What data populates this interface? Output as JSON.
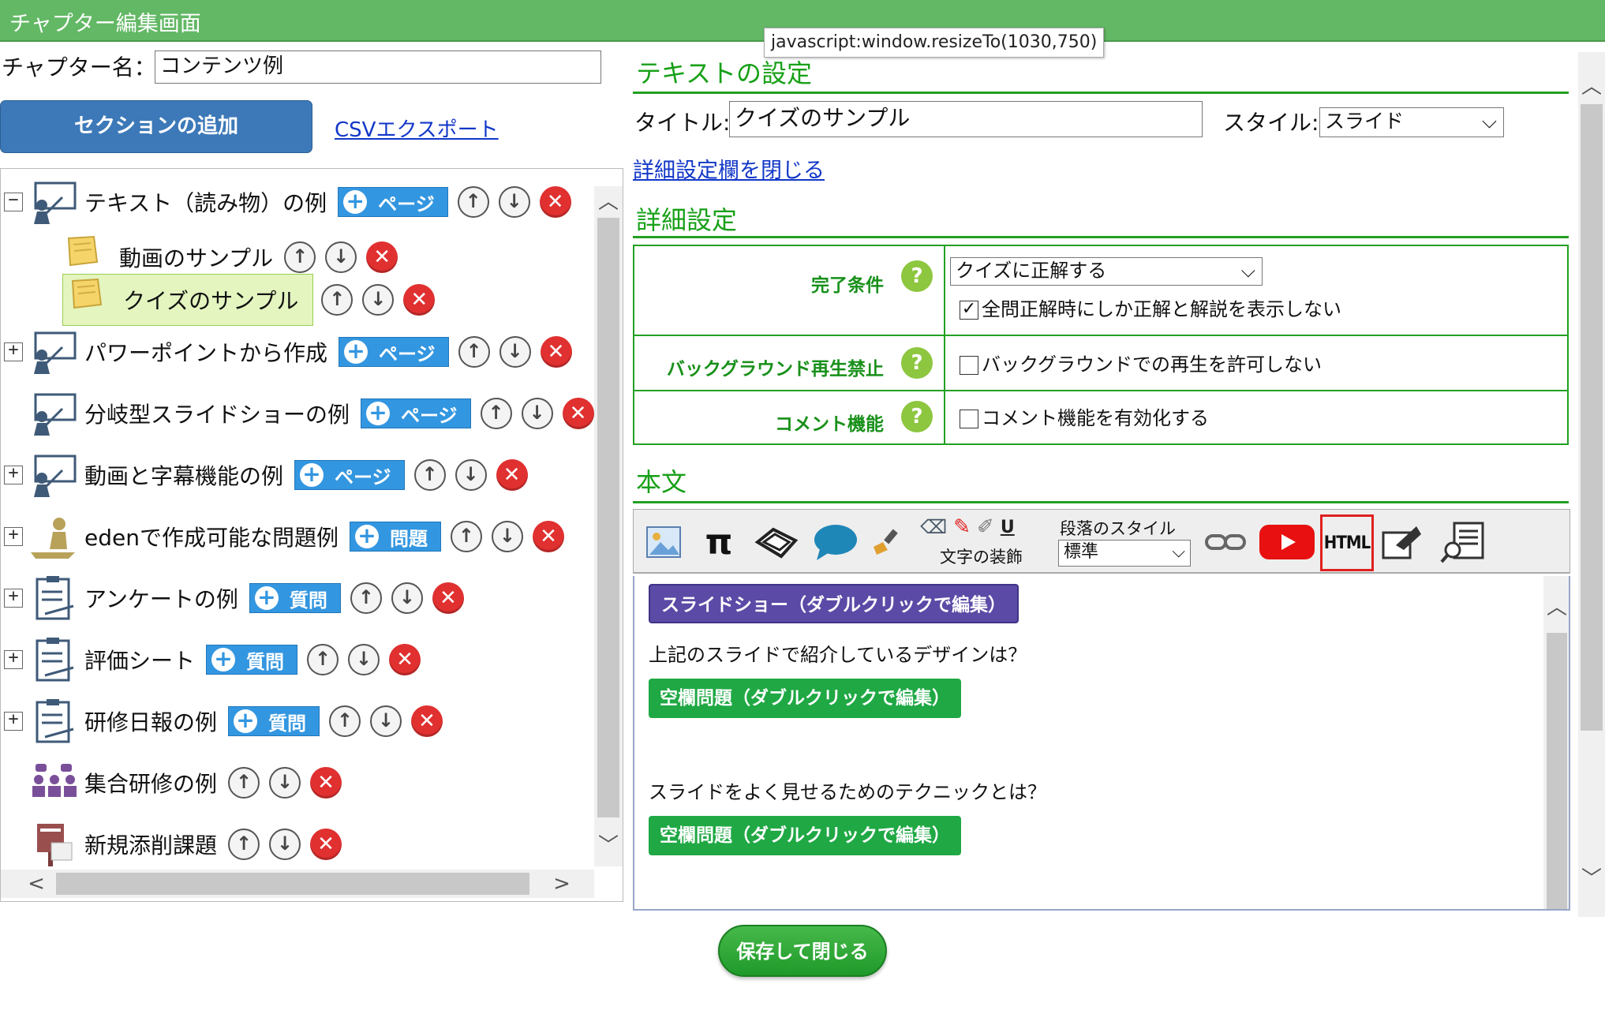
{
  "window": {
    "title": "チャプター編集画面"
  },
  "tooltip": "javascript:window.resizeTo(1030,750)",
  "chapter": {
    "label": "チャプター名：",
    "value": "コンテンツ例"
  },
  "actions": {
    "add_section": "セクションの追加",
    "csv_export": "CSVエクスポート"
  },
  "tree": {
    "nodes": [
      {
        "label": "テキスト（読み物）の例",
        "expander": "−",
        "add": "ページ",
        "icon": "presenter"
      },
      {
        "label": "動画のサンプル",
        "icon": "note"
      },
      {
        "label": "クイズのサンプル",
        "icon": "note",
        "selected": true
      },
      {
        "label": "パワーポイントから作成",
        "expander": "+",
        "add": "ページ",
        "icon": "presenter"
      },
      {
        "label": "分岐型スライドショーの例",
        "add": "ページ",
        "icon": "presenter"
      },
      {
        "label": "動画と字幕機能の例",
        "expander": "+",
        "add": "ページ",
        "icon": "presenter"
      },
      {
        "label": "edenで作成可能な問題例",
        "expander": "+",
        "add": "問題",
        "icon": "student"
      },
      {
        "label": "アンケートの例",
        "expander": "+",
        "add": "質問",
        "icon": "clipboard"
      },
      {
        "label": "評価シート",
        "expander": "+",
        "add": "質問",
        "icon": "clipboard"
      },
      {
        "label": "研修日報の例",
        "expander": "+",
        "add": "質問",
        "icon": "clipboard"
      },
      {
        "label": "集合研修の例",
        "icon": "group"
      },
      {
        "label": "新規添削課題",
        "icon": "post"
      }
    ]
  },
  "text_settings": {
    "heading": "テキストの設定",
    "title_label": "タイトル:",
    "title_value": "クイズのサンプル",
    "style_label": "スタイル:",
    "style_value": "スライド",
    "toggle_link": "詳細設定欄を閉じる"
  },
  "detail": {
    "heading": "詳細設定",
    "completion_label": "完了条件",
    "completion_value": "クイズに正解する",
    "completion_check": "全問正解時にしか正解と解説を表示しない",
    "bg_label": "バックグラウンド再生禁止",
    "bg_check": "バックグラウンドでの再生を許可しない",
    "comment_label": "コメント機能",
    "comment_check": "コメント機能を有効化する"
  },
  "body_section": {
    "heading": "本文",
    "decoration_label": "文字の装飾",
    "para_style_label": "段落のスタイル",
    "para_style_value": "標準",
    "html_label": "HTML",
    "pi": "π"
  },
  "editor": {
    "slideshow": "スライドショー（ダブルクリックで編集）",
    "q1": "上記のスライドで紹介しているデザインは？",
    "blank1": "空欄問題（ダブルクリックで編集）",
    "q2": "スライドをよく見せるためのテクニックとは？",
    "blank2": "空欄問題（ダブルクリックで編集）"
  },
  "save_button": "保存して閉じる",
  "colors": {
    "titlebar": "#63b865",
    "accent_green": "#22a022",
    "blue_button": "#3d79b8",
    "add_button": "#3396e0",
    "delete": "#e03030",
    "slideshow_pill": "#5b4aa6",
    "blank_pill": "#1fa844"
  }
}
